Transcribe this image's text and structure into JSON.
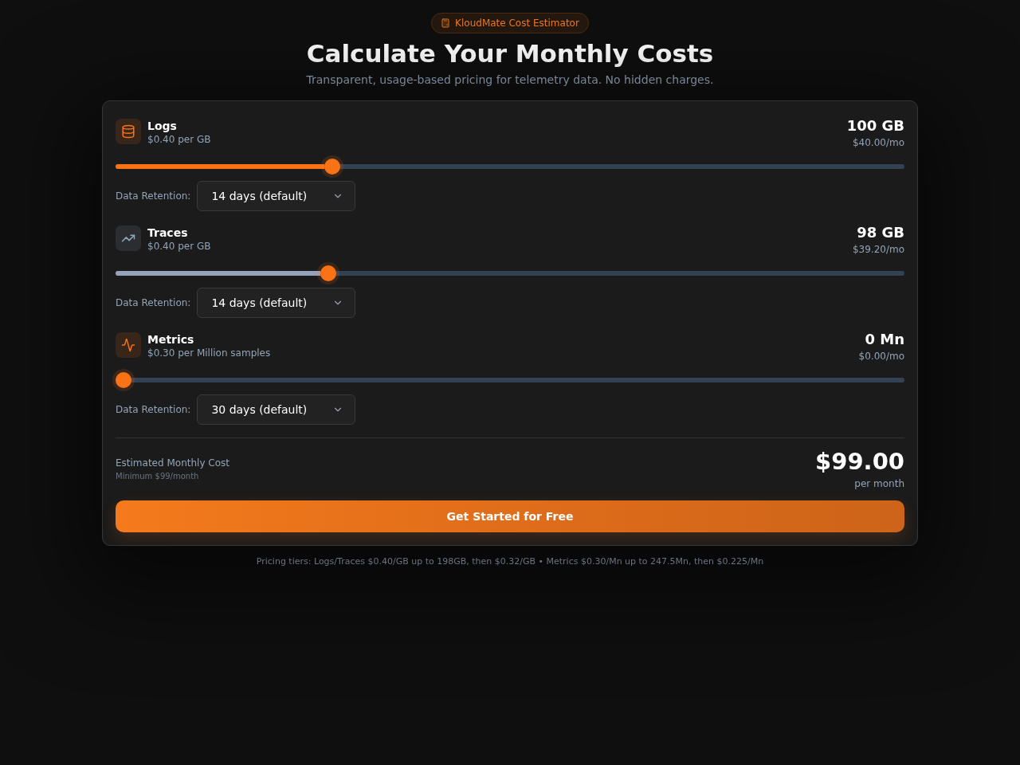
{
  "badge": {
    "label": "KloudMate Cost Estimator"
  },
  "header": {
    "title": "Calculate Your Monthly Costs",
    "subtitle": "Transparent, usage-based pricing for telemetry data. No hidden charges."
  },
  "sources": [
    {
      "kind": "logs",
      "name": "Logs",
      "rate": "$0.40 per GB",
      "amount": "100 GB",
      "cost": "$40.00/mo",
      "level": 0.27,
      "color": "#f97316",
      "retention_label": "Data Retention:",
      "retention": "14 days (default)"
    },
    {
      "kind": "traces",
      "name": "Traces",
      "rate": "$0.40 per GB",
      "amount": "98 GB",
      "cost": "$39.20/mo",
      "level": 0.265,
      "color": "#94a3b8",
      "retention_label": "Data Retention:",
      "retention": "14 days (default)"
    },
    {
      "kind": "metrics",
      "name": "Metrics",
      "rate": "$0.30 per Million samples",
      "amount": "0 Mn",
      "cost": "$0.00/mo",
      "level": 0,
      "color": "#f97316",
      "retention_label": "Data Retention:",
      "retention": "30 days (default)"
    }
  ],
  "summary": {
    "label": "Estimated Monthly Cost",
    "note": "Minimum $99/month",
    "total": "$99.00",
    "period": "per month"
  },
  "cta": {
    "label": "Get Started for Free"
  },
  "footer": {
    "text": "Pricing tiers: Logs/Traces $0.40/GB up to 198GB, then $0.32/GB • Metrics $0.30/Mn up to 247.5Mn, then $0.225/Mn"
  }
}
